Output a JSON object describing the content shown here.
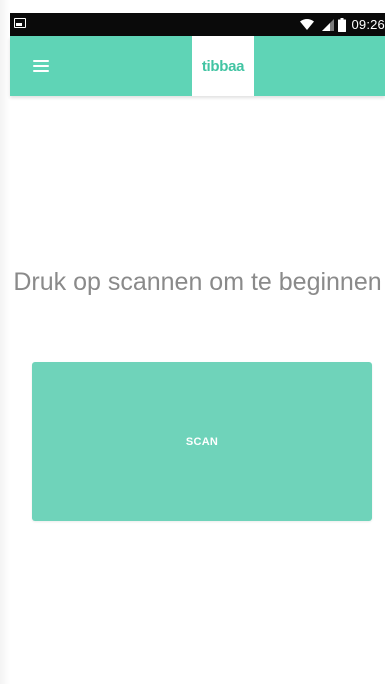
{
  "status_bar": {
    "time": "09:26",
    "icons": [
      "image-notification-icon",
      "wifi-icon",
      "signal-icon",
      "battery-icon"
    ]
  },
  "app_bar": {
    "menu_icon": "hamburger-menu-icon",
    "logo_text": "tibbaa",
    "background_color": "#5fd4b6"
  },
  "main": {
    "prompt": "Druk op scannen om te beginnen",
    "scan_button_label": "SCAN",
    "scan_button_color": "#6fd3ba"
  }
}
